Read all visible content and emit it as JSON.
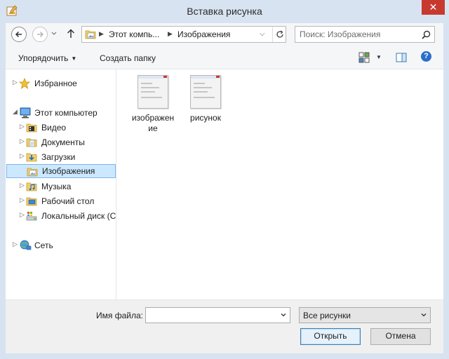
{
  "window": {
    "title": "Вставка рисунка",
    "close_glyph": "✕"
  },
  "address": {
    "crumbs": [
      "Этот компь...",
      "Изображения"
    ]
  },
  "search": {
    "placeholder": "Поиск: Изображения"
  },
  "toolbar": {
    "organize_label": "Упорядочить",
    "new_folder_label": "Создать папку",
    "help_glyph": "?"
  },
  "navpane": {
    "favorites": "Избранное",
    "this_pc": "Этот компьютер",
    "video": "Видео",
    "documents": "Документы",
    "downloads": "Загрузки",
    "pictures": "Изображения",
    "music": "Музыка",
    "desktop": "Рабочий стол",
    "local_disk": "Локальный диск (С",
    "network": "Сеть"
  },
  "files": [
    {
      "name": "изображение",
      "icon": "image-thumbnail"
    },
    {
      "name": "рисунок",
      "icon": "image-thumbnail"
    }
  ],
  "footer": {
    "filename_label": "Имя файла:",
    "filename_value": "",
    "filetype_value": "Все рисунки",
    "open_label": "Открыть",
    "cancel_label": "Отмена"
  },
  "colors": {
    "title_bar": "#d8e3f1",
    "close_button": "#c7392f",
    "selection": "#cce8ff",
    "selection_border": "#7eb4ea",
    "primary_button_border": "#3c7fb1"
  }
}
